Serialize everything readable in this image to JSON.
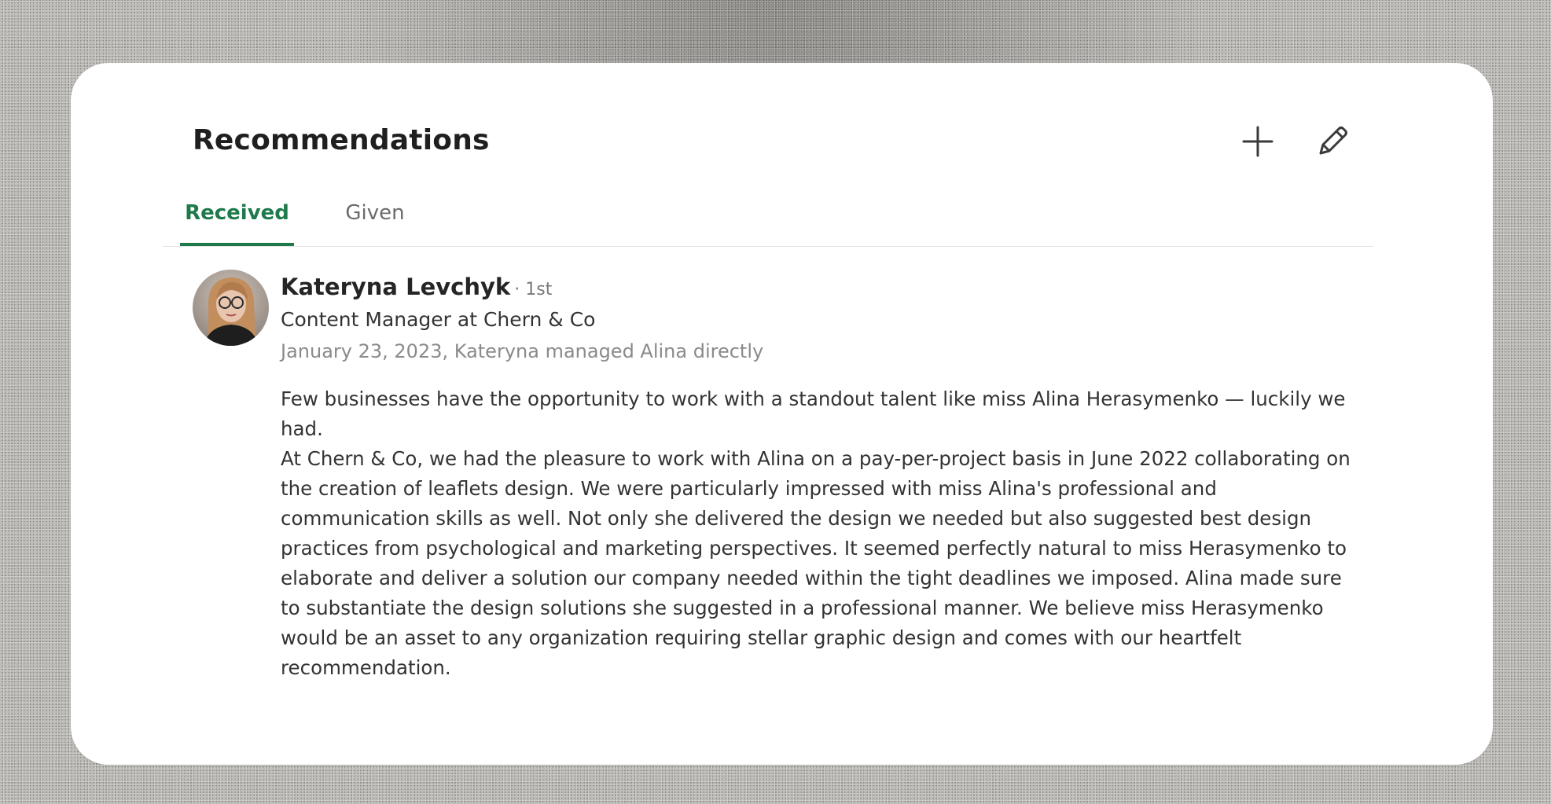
{
  "section": {
    "title": "Recommendations",
    "add_icon": "plus-icon",
    "edit_icon": "pencil-icon"
  },
  "tabs": [
    {
      "label": "Received",
      "active": true
    },
    {
      "label": "Given",
      "active": false
    }
  ],
  "colors": {
    "accent": "#1e7a4b",
    "background": "#b5b3ae",
    "card": "#ffffff"
  },
  "recommendation": {
    "name": "Kateryna Levchyk",
    "degree": "· 1st",
    "headline": "Content Manager at Chern & Co",
    "meta": "January 23, 2023, Kateryna managed Alina directly",
    "paragraphs": [
      "Few businesses have the opportunity to work with a standout talent like miss Alina Herasymenko — luckily we had.",
      "At Chern & Co, we had the pleasure to work with Alina on a pay-per-project basis in June 2022 collaborating on the creation of leaflets design. We were particularly impressed with miss Alina's professional and communication skills as well. Not only she delivered the design we needed but also suggested best design practices from psychological and marketing perspectives. It seemed perfectly natural to miss Herasymenko to elaborate and deliver a solution our company needed within the tight deadlines we imposed. Alina made sure to substantiate the design solutions she suggested in a professional manner. We believe miss Herasymenko would be an asset to any organization requiring stellar graphic design and comes with our heartfelt recommendation."
    ]
  }
}
